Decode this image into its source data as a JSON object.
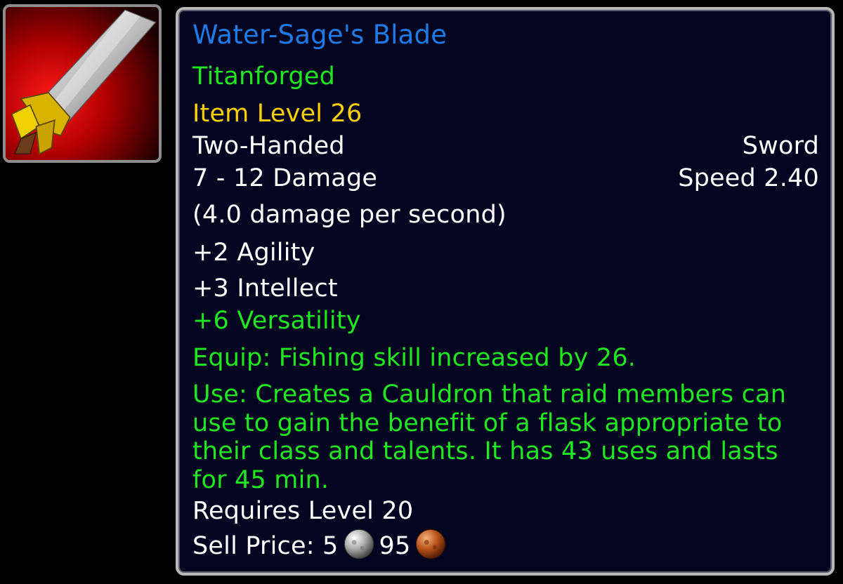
{
  "icon": {
    "name": "sword-icon",
    "background_color": "#b00000"
  },
  "item": {
    "name": "Water-Sage's Blade",
    "name_color": "#1f7be8",
    "quality_tag": "Titanforged",
    "item_level": "Item Level 26",
    "hand": "Two-Handed",
    "weapon_type": "Sword",
    "damage": "7 - 12 Damage",
    "speed": "Speed 2.40",
    "dps": "(4.0 damage per second)",
    "stats": [
      "+2 Agility",
      "+3 Intellect"
    ],
    "bonus_stat": "+6 Versatility",
    "equip_effect": "Equip: Fishing skill increased by 26.",
    "use_effect": "Use: Creates a Cauldron that raid members can use to gain the benefit of a flask appropriate to their class and talents. It has 43 uses and lasts for 45 min.",
    "requirement": "Requires Level 20",
    "sell_price": {
      "label": "Sell Price:",
      "silver": "5",
      "copper": "95",
      "silver_icon": "silver-coin-icon",
      "copper_icon": "copper-coin-icon"
    }
  },
  "colors": {
    "green_text": "#20e820",
    "yellow_text": "#ffd000",
    "white_text": "#ffffff",
    "tooltip_bg": "#030520"
  }
}
